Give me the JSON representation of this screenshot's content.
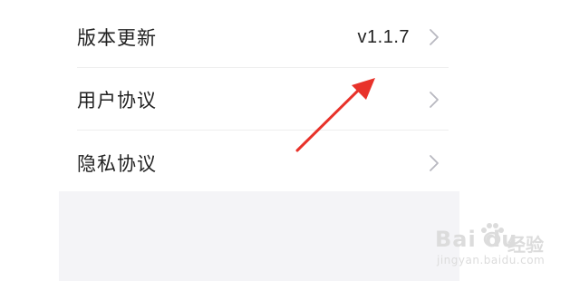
{
  "settings": {
    "items": [
      {
        "label": "版本更新",
        "value": "v1.1.7",
        "icon": "chevron-right-icon"
      },
      {
        "label": "用户协议",
        "icon": "chevron-right-icon"
      },
      {
        "label": "隐私协议",
        "icon": "chevron-right-icon"
      }
    ]
  },
  "annotation": {
    "icon": "red-arrow-icon",
    "color": "#e8322a"
  },
  "watermark": {
    "brand": "Bai du",
    "brand_cn": "经验",
    "url": "jingyan.baidu.com",
    "color": "#dcdcdc"
  }
}
